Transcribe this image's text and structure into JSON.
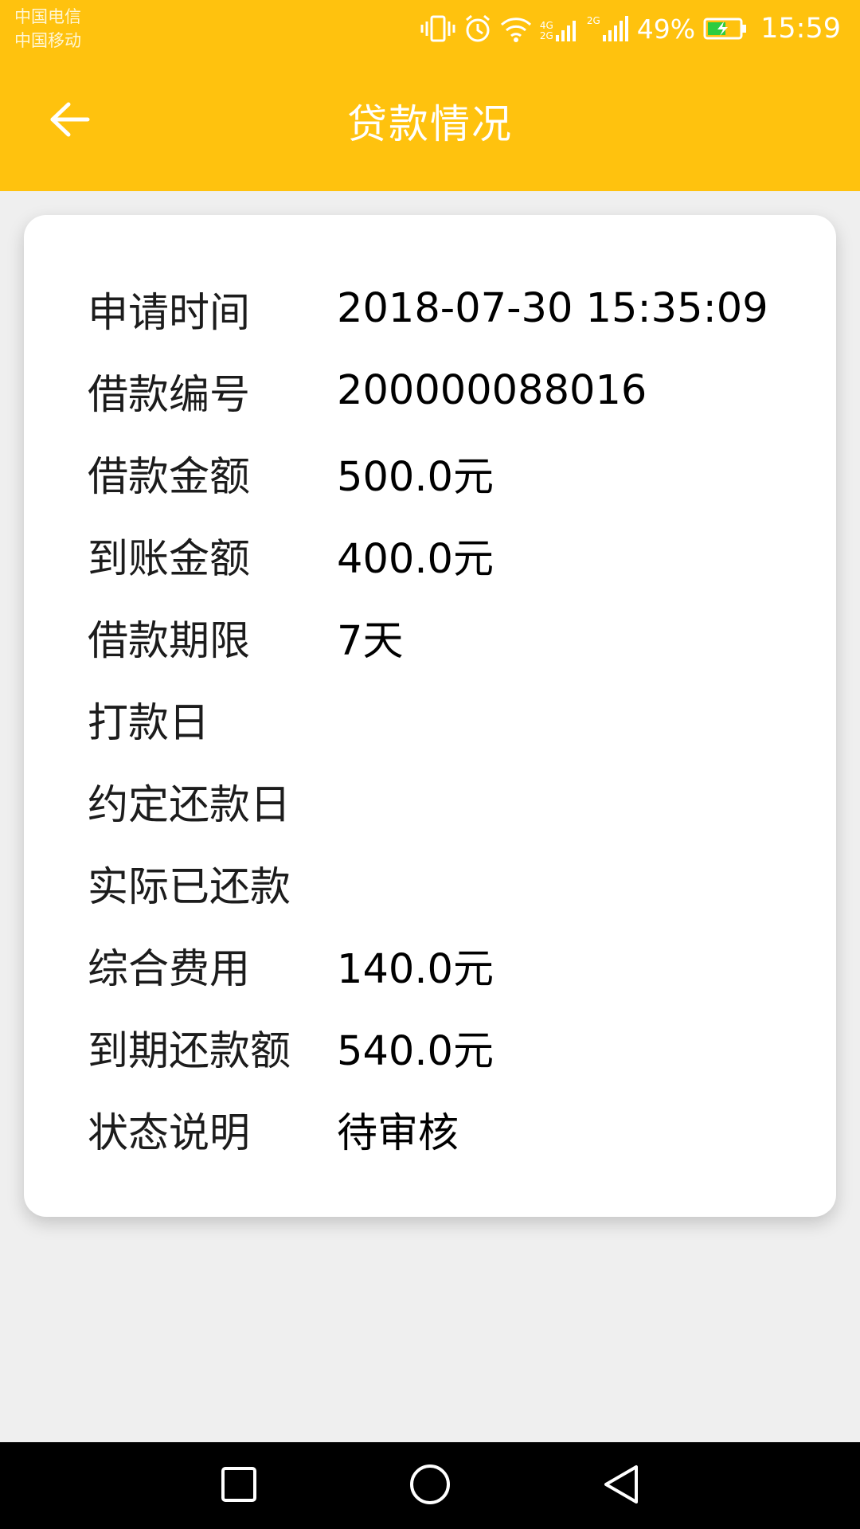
{
  "status_bar": {
    "carrier_1": "中国电信",
    "carrier_2": "中国移动",
    "network_1": "4G",
    "network_1b": "2G",
    "network_2": "2G",
    "battery_percent": "49%",
    "time": "15:59"
  },
  "header": {
    "title": "贷款情况",
    "back_icon": "arrow-left-icon"
  },
  "loan_details": [
    {
      "label": "申请时间",
      "value": "2018-07-30 15:35:09"
    },
    {
      "label": "借款编号",
      "value": "200000088016"
    },
    {
      "label": "借款金额",
      "value": "500.0元"
    },
    {
      "label": "到账金额",
      "value": "400.0元"
    },
    {
      "label": "借款期限",
      "value": "7天"
    },
    {
      "label": "打款日",
      "value": ""
    },
    {
      "label": "约定还款日",
      "value": ""
    },
    {
      "label": "实际已还款",
      "value": ""
    },
    {
      "label": "综合费用",
      "value": "140.0元"
    },
    {
      "label": "到期还款额",
      "value": "540.0元"
    },
    {
      "label": "状态说明",
      "value": "待审核"
    }
  ],
  "nav_bar": {
    "recents_icon": "square-icon",
    "home_icon": "circle-icon",
    "back_icon": "triangle-back-icon"
  },
  "colors": {
    "accent": "#FFC20E",
    "background": "#EFEFEF",
    "card": "#FFFFFF",
    "nav_bar": "#000000"
  }
}
